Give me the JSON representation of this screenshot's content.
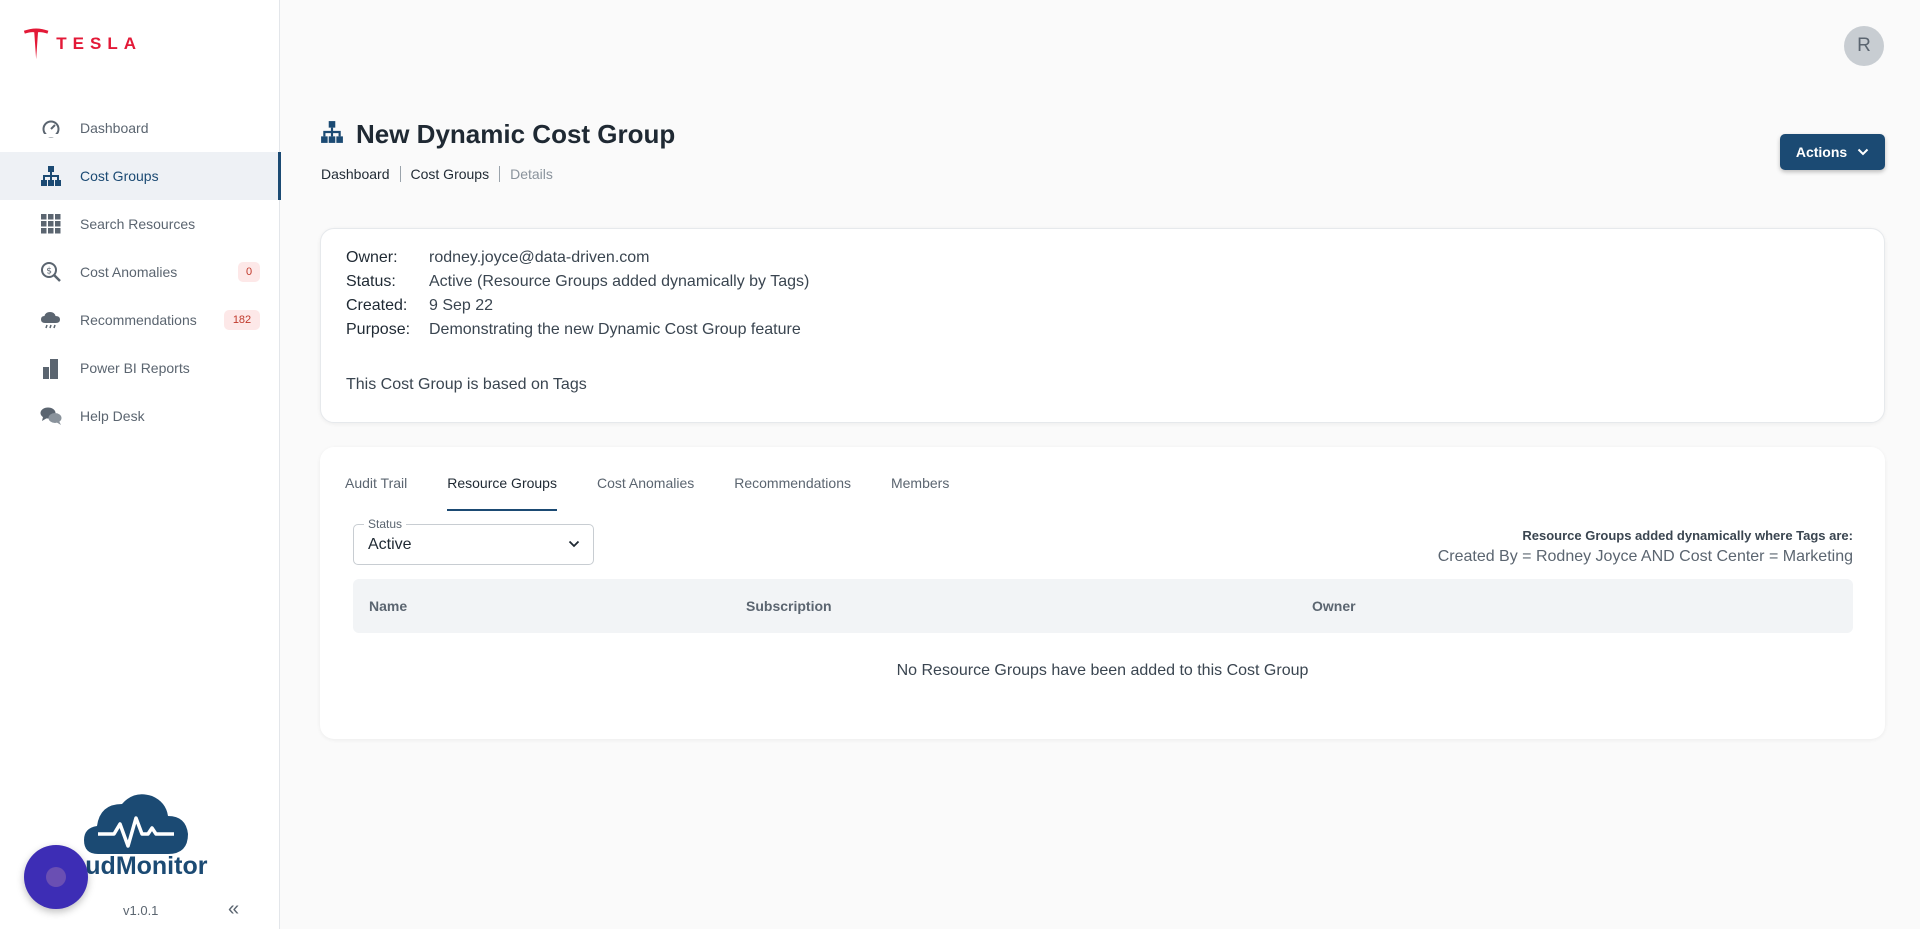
{
  "brand": {
    "name": "TESLA",
    "accent": "#e31937"
  },
  "sidebar": {
    "items": [
      {
        "label": "Dashboard",
        "icon": "dashboard-gauge-icon",
        "badge": null,
        "active": false
      },
      {
        "label": "Cost Groups",
        "icon": "hierarchy-icon",
        "badge": null,
        "active": true
      },
      {
        "label": "Search Resources",
        "icon": "grid-icon",
        "badge": null,
        "active": false
      },
      {
        "label": "Cost Anomalies",
        "icon": "magnifier-dollar-icon",
        "badge": "0",
        "active": false
      },
      {
        "label": "Recommendations",
        "icon": "cloud-rain-icon",
        "badge": "182",
        "active": false
      },
      {
        "label": "Power BI Reports",
        "icon": "bar-building-icon",
        "badge": null,
        "active": false
      },
      {
        "label": "Help Desk",
        "icon": "chat-bubbles-icon",
        "badge": null,
        "active": false
      }
    ],
    "product_logo_text": "oudMonitor",
    "version": "v1.0.1",
    "collapse_glyph": "«"
  },
  "header": {
    "avatar_initial": "R",
    "title": "New Dynamic Cost Group",
    "title_icon": "hierarchy-icon",
    "breadcrumb": [
      "Dashboard",
      "Cost Groups",
      "Details"
    ],
    "actions_label": "Actions"
  },
  "details": {
    "owner_label": "Owner:",
    "owner": "rodney.joyce@data-driven.com",
    "status_label": "Status:",
    "status": "Active (Resource Groups added dynamically by Tags)",
    "created_label": "Created:",
    "created": "9 Sep 22",
    "purpose_label": "Purpose:",
    "purpose": "Demonstrating the new Dynamic Cost Group feature",
    "basis": "This Cost Group is based on Tags"
  },
  "tabs": [
    {
      "label": "Audit Trail",
      "active": false
    },
    {
      "label": "Resource Groups",
      "active": true
    },
    {
      "label": "Cost Anomalies",
      "active": false
    },
    {
      "label": "Recommendations",
      "active": false
    },
    {
      "label": "Members",
      "active": false
    }
  ],
  "resource_groups": {
    "status_legend": "Status",
    "status_value": "Active",
    "rule_title": "Resource Groups added dynamically where Tags are:",
    "rule_expression": "Created By = Rodney Joyce AND Cost Center = Marketing",
    "columns": [
      "Name",
      "Subscription",
      "Owner"
    ],
    "empty_message": "No Resource Groups have been added to this Cost Group"
  },
  "colors": {
    "primary": "#1b4a73",
    "badge_bg": "#fde8e8",
    "badge_text": "#c0392b",
    "fab": "#3d2db5"
  }
}
